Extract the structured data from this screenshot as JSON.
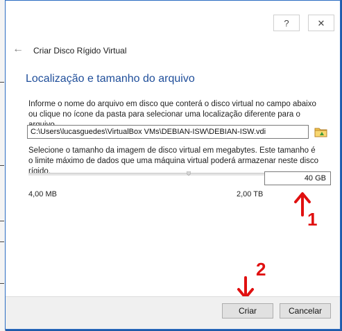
{
  "window": {
    "help_button": "?",
    "close_button": "✕"
  },
  "wizard": {
    "title": "Criar Disco Rígido Virtual",
    "section_title": "Localização e tamanho do arquivo",
    "location_description": "Informe o nome do arquivo em disco que conterá o disco virtual no campo abaixo ou clique no ícone da pasta para selecionar uma localização diferente para o arquivo.",
    "file_path": "C:\\Users\\lucasguedes\\VirtualBox VMs\\DEBIAN-ISW\\DEBIAN-ISW.vdi",
    "size_description": "Selecione o tamanho da imagem de disco virtual em megabytes. Este tamanho é o limite máximo de dados que uma máquina virtual poderá armazenar neste disco rígido.",
    "size_value": "40 GB",
    "size_min_label": "4,00 MB",
    "size_max_label": "2,00 TB"
  },
  "annotations": {
    "marker_1": "1",
    "marker_2": "2",
    "color": "#e01010"
  },
  "footer": {
    "create_label": "Criar",
    "cancel_label": "Cancelar"
  },
  "icons": {
    "back": "back-arrow-icon",
    "folder": "folder-icon",
    "help": "help-icon",
    "close": "close-icon"
  }
}
